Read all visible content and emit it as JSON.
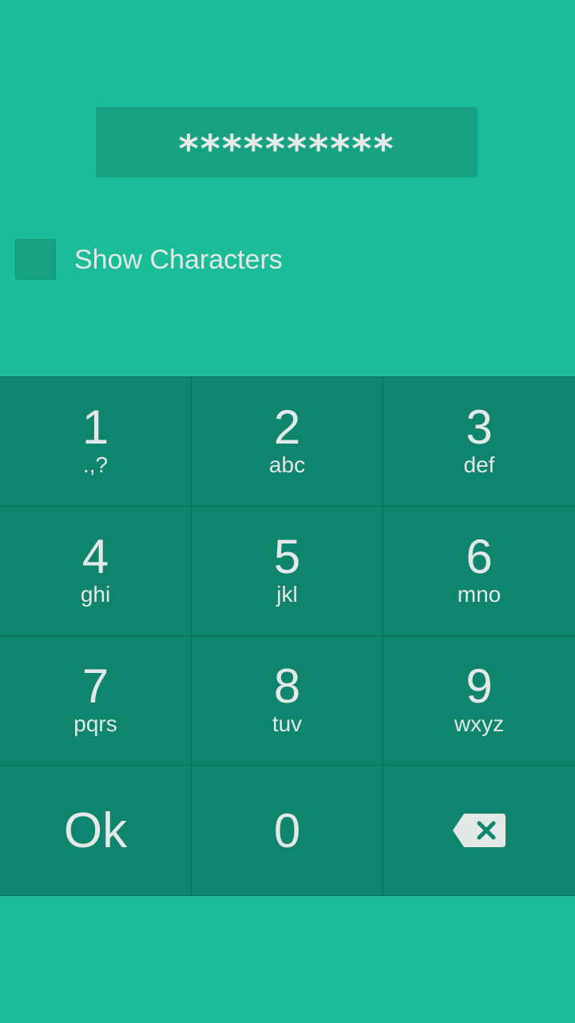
{
  "password": {
    "masked_value": "**********"
  },
  "show_characters": {
    "label": "Show Characters",
    "checked": false
  },
  "keypad": {
    "keys": [
      {
        "digit": "1",
        "letters": ".,?"
      },
      {
        "digit": "2",
        "letters": "abc"
      },
      {
        "digit": "3",
        "letters": "def"
      },
      {
        "digit": "4",
        "letters": "ghi"
      },
      {
        "digit": "5",
        "letters": "jkl"
      },
      {
        "digit": "6",
        "letters": "mno"
      },
      {
        "digit": "7",
        "letters": "pqrs"
      },
      {
        "digit": "8",
        "letters": "tuv"
      },
      {
        "digit": "9",
        "letters": "wxyz"
      }
    ],
    "ok_label": "Ok",
    "zero_label": "0",
    "backspace_icon": "backspace-icon"
  },
  "colors": {
    "background": "#1bbd99",
    "keypad": "#0e856c",
    "text": "#e3e9e6"
  }
}
